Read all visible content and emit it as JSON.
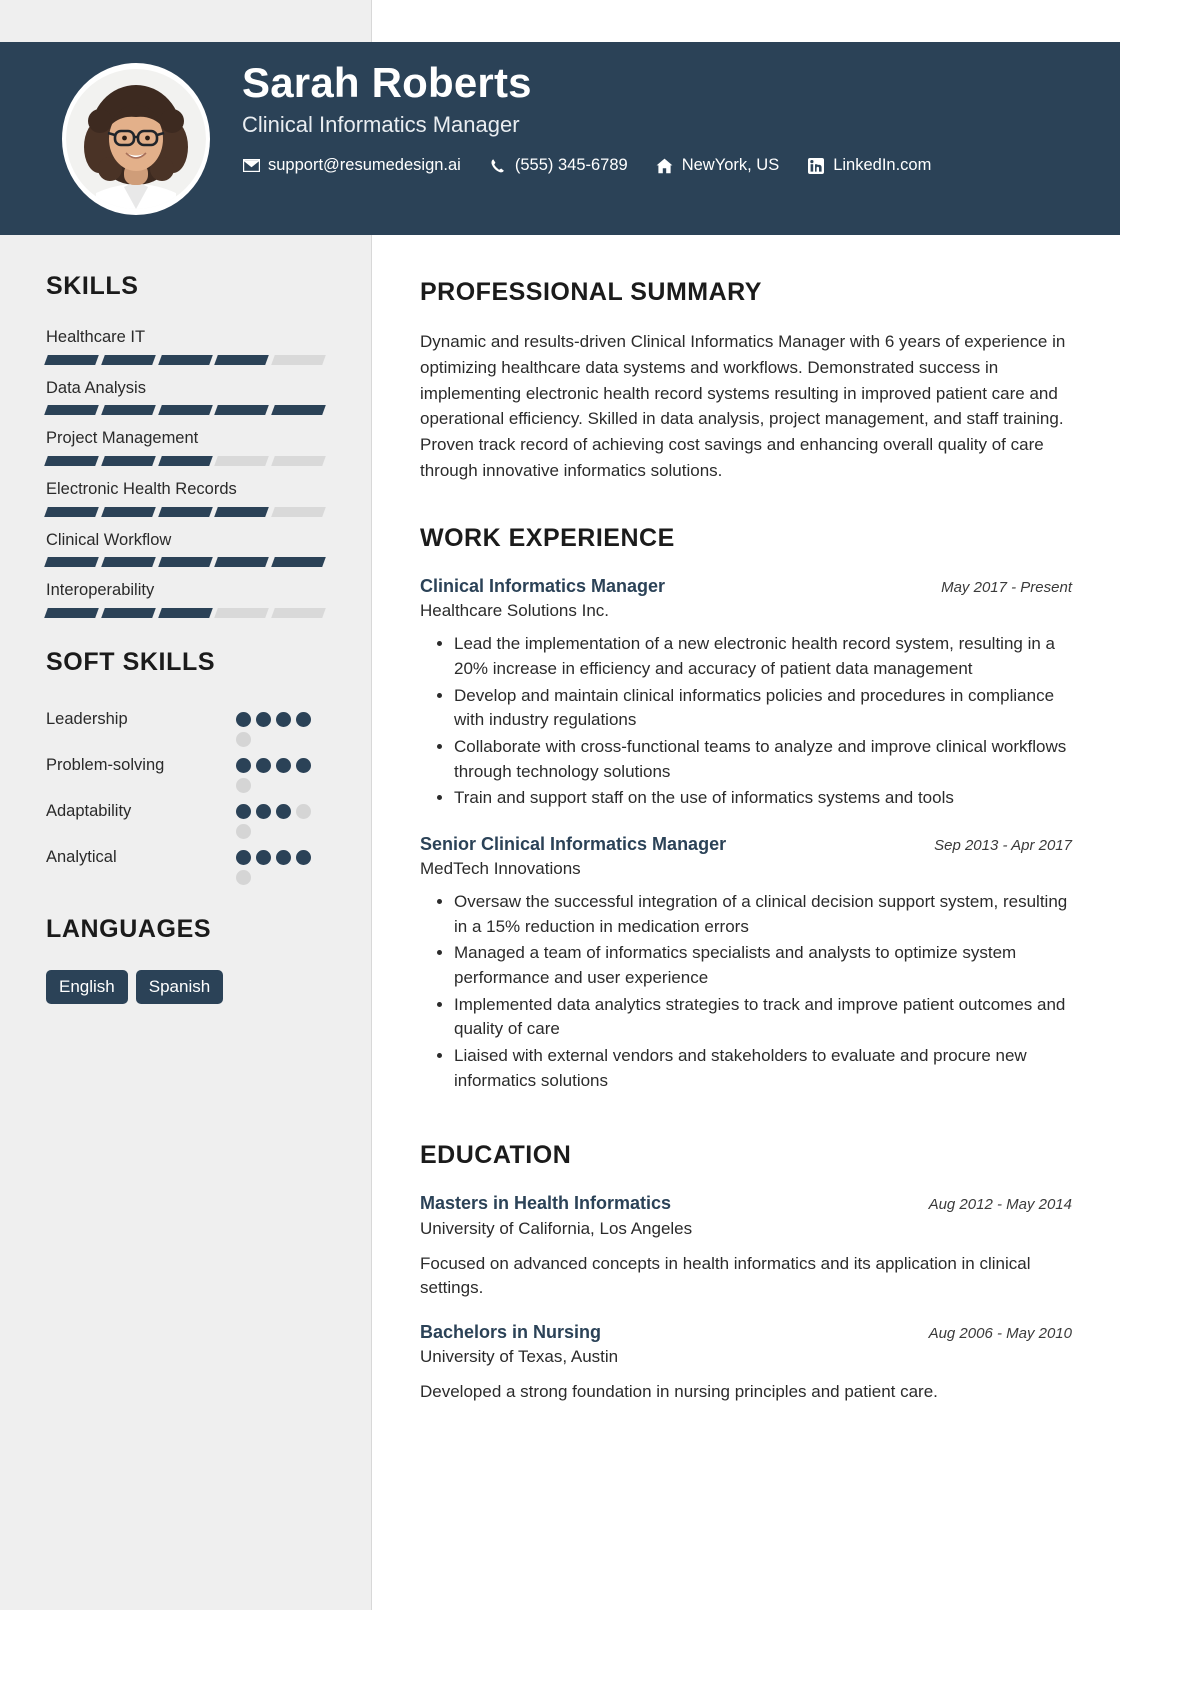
{
  "theme": {
    "navy": "#2b4257",
    "rail_bg": "#efefef",
    "bar_off": "#d9d9d9",
    "dot_off": "#d5d5d5",
    "link_blue": "#2b4257"
  },
  "header": {
    "name": "Sarah Roberts",
    "role": "Clinical Informatics Manager",
    "contacts": [
      {
        "icon": "envelope-icon",
        "text": "support@resumedesign.ai"
      },
      {
        "icon": "phone-icon",
        "text": "(555) 345-6789"
      },
      {
        "icon": "home-icon",
        "text": "NewYork, US"
      },
      {
        "icon": "linkedin-icon",
        "text": "LinkedIn.com"
      }
    ]
  },
  "sidebar": {
    "skills_heading": "SKILLS",
    "skills": [
      {
        "name": "Healthcare IT",
        "level": 4,
        "max": 5
      },
      {
        "name": "Data Analysis",
        "level": 5,
        "max": 5
      },
      {
        "name": "Project Management",
        "level": 3,
        "max": 5
      },
      {
        "name": "Electronic Health Records",
        "level": 4,
        "max": 5
      },
      {
        "name": "Clinical Workflow",
        "level": 5,
        "max": 5
      },
      {
        "name": "Interoperability",
        "level": 3,
        "max": 5
      }
    ],
    "soft_skills_heading": "SOFT SKILLS",
    "soft_skills": [
      {
        "name": "Leadership",
        "level": 4,
        "max": 5
      },
      {
        "name": "Problem-solving",
        "level": 4,
        "max": 5
      },
      {
        "name": "Adaptability",
        "level": 3,
        "max": 5
      },
      {
        "name": "Analytical",
        "level": 4,
        "max": 5
      }
    ],
    "languages_heading": "LANGUAGES",
    "languages": [
      "English",
      "Spanish"
    ]
  },
  "main": {
    "summary_heading": "PROFESSIONAL SUMMARY",
    "summary_text": "Dynamic and results-driven Clinical Informatics Manager with 6 years of experience in optimizing healthcare data systems and workflows. Demonstrated success in implementing electronic health record systems resulting in improved patient care and operational efficiency. Skilled in data analysis, project management, and staff training. Proven track record of achieving cost savings and enhancing overall quality of care through innovative informatics solutions.",
    "work_heading": "WORK EXPERIENCE",
    "work": [
      {
        "title": "Clinical Informatics Manager",
        "date": "May 2017 - Present",
        "org": "Healthcare Solutions Inc.",
        "bullets": [
          "Lead the implementation of a new electronic health record system, resulting in a 20% increase in efficiency and accuracy of patient data management",
          "Develop and maintain clinical informatics policies and procedures in compliance with industry regulations",
          "Collaborate with cross-functional teams to analyze and improve clinical workflows through technology solutions",
          "Train and support staff on the use of informatics systems and tools"
        ]
      },
      {
        "title": "Senior Clinical Informatics Manager",
        "date": "Sep 2013 - Apr 2017",
        "org": "MedTech Innovations",
        "bullets": [
          "Oversaw the successful integration of a clinical decision support system, resulting in a 15% reduction in medication errors",
          "Managed a team of informatics specialists and analysts to optimize system performance and user experience",
          "Implemented data analytics strategies to track and improve patient outcomes and quality of care",
          "Liaised with external vendors and stakeholders to evaluate and procure new informatics solutions"
        ]
      }
    ],
    "education_heading": "EDUCATION",
    "education": [
      {
        "degree": "Masters in Health Informatics",
        "date": "Aug 2012 - May 2014",
        "school": "University of California, Los Angeles",
        "description": "Focused on advanced concepts in health informatics and its application in clinical settings."
      },
      {
        "degree": "Bachelors in Nursing",
        "date": "Aug 2006 - May 2010",
        "school": "University of Texas, Austin",
        "description": "Developed a strong foundation in nursing principles and patient care."
      }
    ]
  }
}
